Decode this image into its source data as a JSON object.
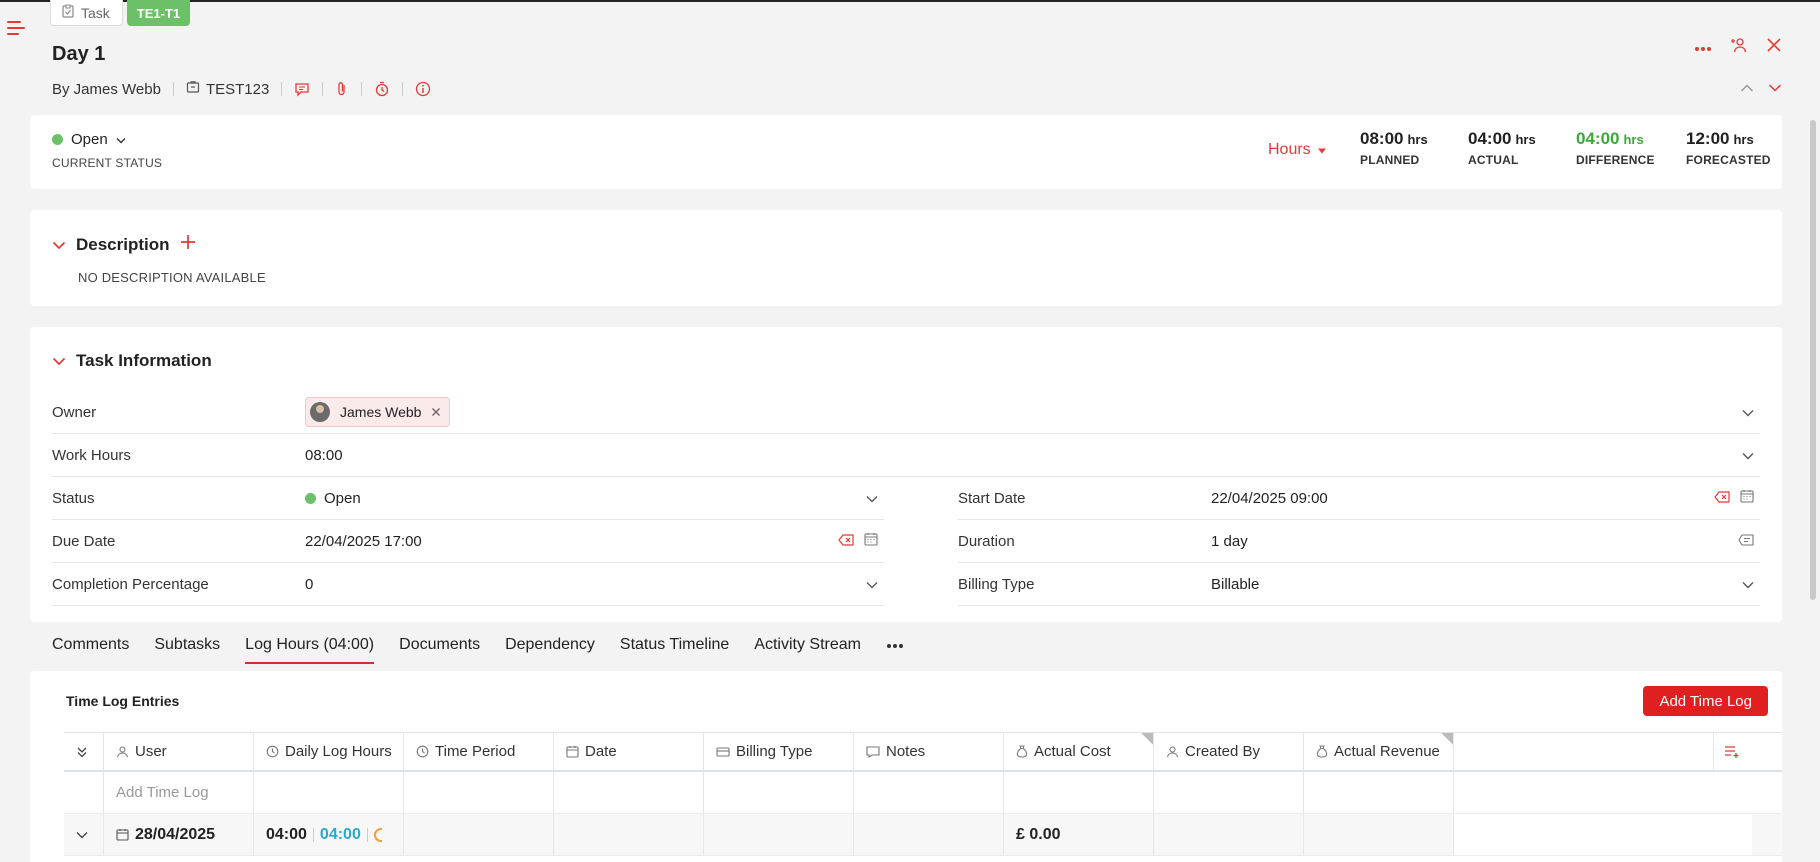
{
  "header": {
    "crumb_type": "Task",
    "crumb_id": "TE1-T1",
    "title": "Day 1",
    "author": "By James Webb",
    "project": "TEST123"
  },
  "status": {
    "value": "Open",
    "label": "CURRENT STATUS",
    "unit_select": "Hours",
    "metrics": [
      {
        "value": "08:00",
        "unit": "hrs",
        "label": "PLANNED",
        "color": "#222222"
      },
      {
        "value": "04:00",
        "unit": "hrs",
        "label": "ACTUAL",
        "color": "#222222"
      },
      {
        "value": "04:00",
        "unit": "hrs",
        "label": "DIFFERENCE",
        "color": "#3aa83a"
      },
      {
        "value": "12:00",
        "unit": "hrs",
        "label": "FORECASTED",
        "color": "#222222"
      }
    ]
  },
  "description": {
    "title": "Description",
    "empty_text": "NO DESCRIPTION AVAILABLE"
  },
  "task_info": {
    "title": "Task Information",
    "owner_label": "Owner",
    "owner_value": "James Webb",
    "work_hours_label": "Work Hours",
    "work_hours_value": "08:00",
    "status_label": "Status",
    "status_value": "Open",
    "start_date_label": "Start Date",
    "start_date_value": "22/04/2025 09:00",
    "due_date_label": "Due Date",
    "due_date_value": "22/04/2025 17:00",
    "duration_label": "Duration",
    "duration_value": "1 day",
    "completion_label": "Completion Percentage",
    "completion_value": "0",
    "billing_label": "Billing Type",
    "billing_value": "Billable"
  },
  "tabs": [
    "Comments",
    "Subtasks",
    "Log Hours (04:00)",
    "Documents",
    "Dependency",
    "Status Timeline",
    "Activity Stream"
  ],
  "time_log": {
    "title": "Time Log Entries",
    "add_button": "Add Time Log",
    "columns": [
      "User",
      "Daily Log Hours",
      "Time Period",
      "Date",
      "Billing Type",
      "Notes",
      "Actual Cost",
      "Created By",
      "Actual Revenue"
    ],
    "add_row_placeholder": "Add Time Log",
    "group_row": {
      "date": "28/04/2025",
      "hours": "04:00",
      "billable_hours": "04:00",
      "cost": "£ 0.00"
    }
  },
  "colors": {
    "accent": "#e53935",
    "status_open": "#6cc068",
    "difference": "#3aa83a",
    "billable_hours": "#29a9d6"
  }
}
